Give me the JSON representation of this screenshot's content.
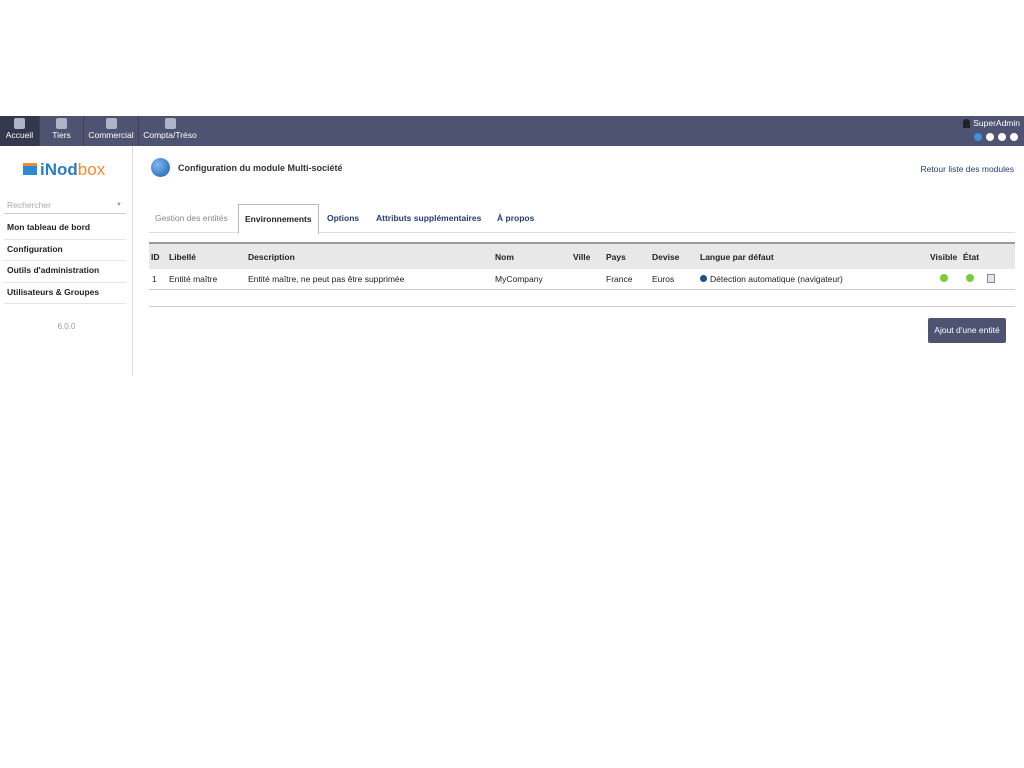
{
  "nav": {
    "items": [
      {
        "label": "Accueil",
        "icon": "home-icon"
      },
      {
        "label": "Tiers",
        "icon": "building-icon"
      },
      {
        "label": "Commercial",
        "icon": "person-icon"
      },
      {
        "label": "Compta/Tréso",
        "icon": "coins-icon"
      }
    ],
    "user": "SuperAdmin"
  },
  "sidebar": {
    "logo": "iNodbox",
    "logo_a": "iNod",
    "logo_b": "box",
    "search_placeholder": "Rechercher",
    "items": [
      "Mon tableau de bord",
      "Configuration",
      "Outils d'administration",
      "Utilisateurs & Groupes"
    ],
    "version": "6.0.0"
  },
  "page": {
    "title": "Configuration du module Multi-société",
    "back_link": "Retour liste des modules"
  },
  "tabs": [
    "Gestion des entités",
    "Environnements",
    "Options",
    "Attributs supplémentaires",
    "À propos"
  ],
  "table": {
    "headers": [
      "ID",
      "Libellé",
      "Description",
      "Nom",
      "Ville",
      "Pays",
      "Devise",
      "Langue par défaut",
      "Visible",
      "État"
    ],
    "rows": [
      {
        "id": "1",
        "label": "Entité maître",
        "description": "Entité maître, ne peut pas être supprimée",
        "name": "MyCompany",
        "city": "",
        "country": "France",
        "currency": "Euros",
        "language": "Détection automatique (navigateur)",
        "visible": true,
        "state": true
      }
    ]
  },
  "add_button": "Ajout d'une entité",
  "colors": {
    "nav": "#4d5370",
    "link": "#263c7a",
    "status_on": "#7ccb3a"
  }
}
